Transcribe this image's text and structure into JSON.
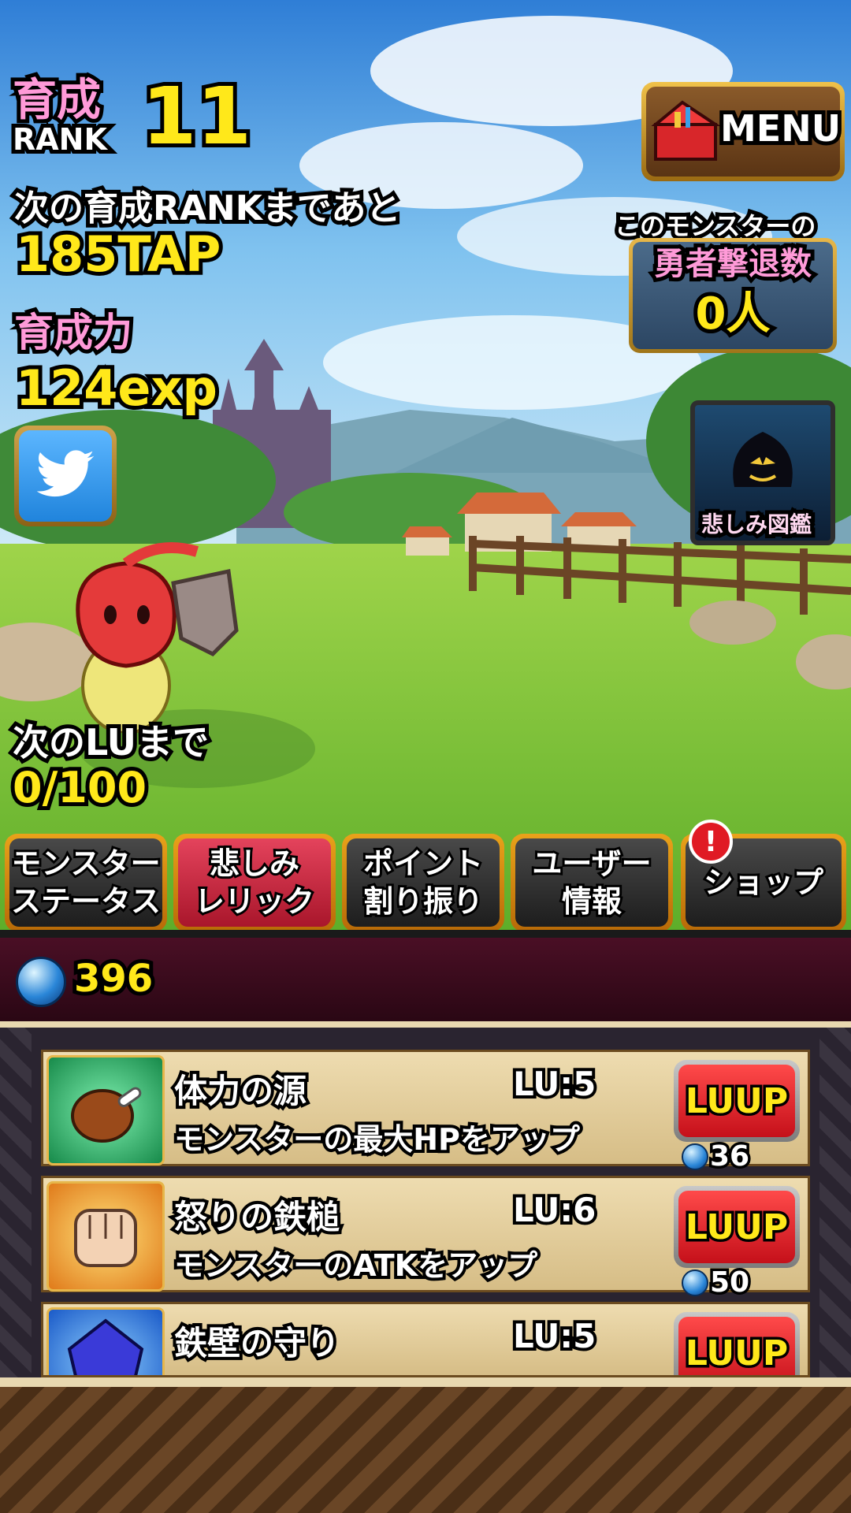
{
  "rank": {
    "label_top": "育成",
    "label_bottom": "RANK",
    "value": "11"
  },
  "next_rank": {
    "text": "次の育成RANKまであと",
    "taps": "185TAP"
  },
  "power": {
    "label": "育成力",
    "value": "124exp"
  },
  "twitter": {
    "icon": "twitter-bird-icon"
  },
  "menu": {
    "label": "MENU",
    "icon": "toolbox-icon"
  },
  "defeated": {
    "label_top": "このモンスターの",
    "label_main": "勇者撃退数",
    "value": "0人"
  },
  "sorrow_book": {
    "label": "悲しみ図鑑",
    "icon": "pumpkin-ghost-icon"
  },
  "next_lv": {
    "label": "次のLUまで",
    "value": "0/100"
  },
  "tabs": [
    {
      "label": "モンスター\nステータス",
      "active": false
    },
    {
      "label": "悲しみ\nレリック",
      "active": true
    },
    {
      "label": "ポイント\n割り振り",
      "active": false
    },
    {
      "label": "ユーザー\n情報",
      "active": false
    },
    {
      "label": "ショップ",
      "active": false,
      "alert": "!"
    }
  ],
  "currency": {
    "icon": "blue-gem-icon",
    "value": "396"
  },
  "relics": [
    {
      "name": "体力の源",
      "level": "LU:5",
      "desc": "モンスターの最大HPをアップ",
      "button": "LUUP",
      "cost": "36",
      "icon": "meat-icon"
    },
    {
      "name": "怒りの鉄槌",
      "level": "LU:6",
      "desc": "モンスターのATKをアップ",
      "button": "LUUP",
      "cost": "50",
      "icon": "fist-icon"
    },
    {
      "name": "鉄壁の守り",
      "level": "LU:5",
      "desc": "",
      "button": "LUUP",
      "cost": "",
      "icon": "blue-crystal-icon"
    }
  ],
  "colors": {
    "accent_yellow": "#ffe81a",
    "pink": "#ff9ad8",
    "active_tab": "#d02a41",
    "tab_border": "#e9a21a"
  }
}
